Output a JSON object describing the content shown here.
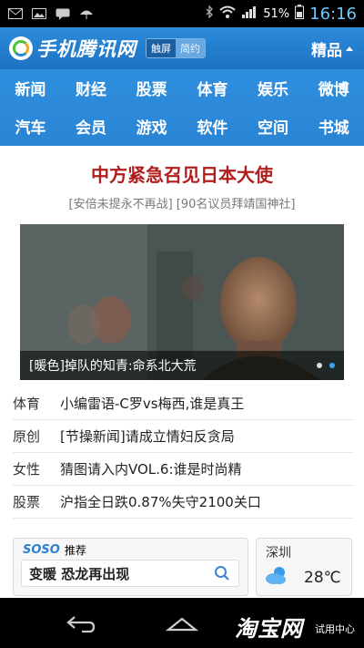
{
  "status_bar": {
    "battery": "51%",
    "time": "16:16"
  },
  "header": {
    "app_title": "手机腾讯网",
    "modes": [
      "触屏",
      "简约"
    ],
    "premium_label": "精品"
  },
  "nav": {
    "row1": [
      "新闻",
      "财经",
      "股票",
      "体育",
      "娱乐",
      "微博"
    ],
    "row2": [
      "汽车",
      "会员",
      "游戏",
      "软件",
      "空间",
      "书城"
    ]
  },
  "headline": {
    "title": "中方紧急召见日本大使",
    "sub1": "[安倍未提永不再战]",
    "sub2": "[90名议员拜靖国神社]"
  },
  "carousel": {
    "caption": "[暖色]掉队的知青:命系北大荒",
    "active_index": 1,
    "count": 2
  },
  "news": [
    {
      "category": "体育",
      "title": "小编雷语-C罗vs梅西,谁是真王"
    },
    {
      "category": "原创",
      "title": "[节操新闻]请成立情妇反贪局"
    },
    {
      "category": "女性",
      "title": "猜图请入内VOL.6:谁是时尚精"
    },
    {
      "category": "股票",
      "title": "沪指全日跌0.87%失守2100关口"
    }
  ],
  "search": {
    "brand": "SOSO",
    "label": "推荐",
    "query": "变暖 恐龙再出现"
  },
  "weather": {
    "city": "深圳",
    "temp": "28℃",
    "icon": "partly-cloudy-icon"
  },
  "watermark": {
    "main": "淘宝网",
    "sub": "试用中心"
  },
  "colors": {
    "header_blue": "#1e72c4",
    "headline_red": "#b11e1e",
    "accent_dot": "#3ea0f0"
  }
}
